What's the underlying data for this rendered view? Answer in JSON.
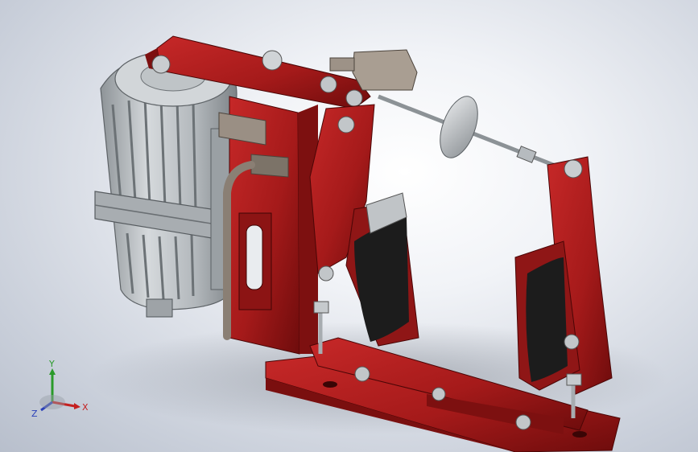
{
  "viewport": {
    "background_center": "#ffffff",
    "background_edge": "#b8bfcc"
  },
  "model": {
    "primary_color": "#a51a1a",
    "primary_dark": "#6e0c0c",
    "motor_color": "#b9bec2",
    "metal_color": "#c8ccd0",
    "rubber_color": "#1c1c1c"
  },
  "triad": {
    "y_label": "Y",
    "x_label": "X",
    "z_label": "Z",
    "y_color": "#2a9a2a",
    "x_color": "#c42020",
    "z_color": "#2a3fb8"
  }
}
